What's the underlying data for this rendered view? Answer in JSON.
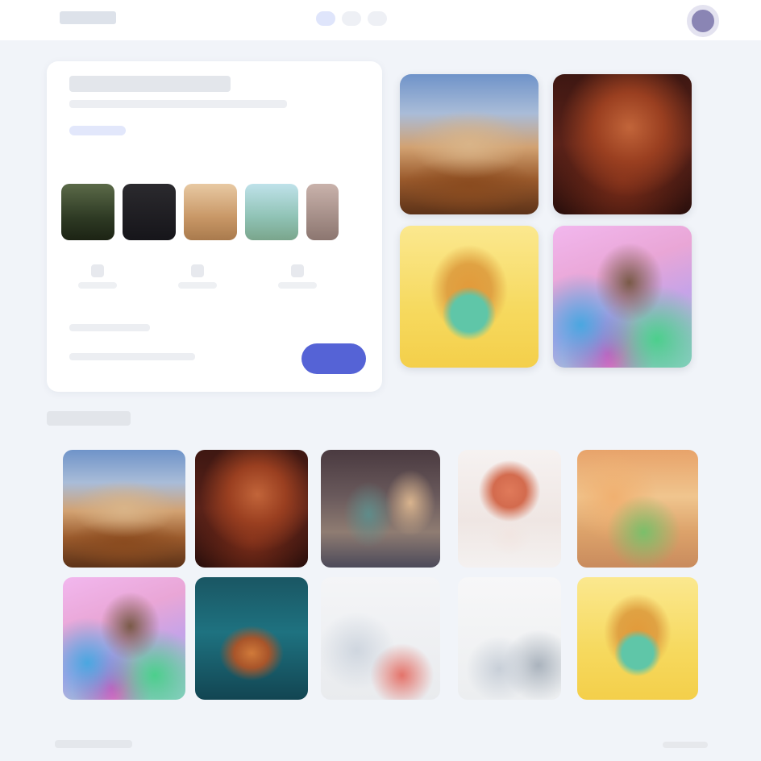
{
  "header": {
    "brand": "",
    "nav": [
      {
        "label": "",
        "active": true
      },
      {
        "label": "",
        "active": false
      },
      {
        "label": "",
        "active": false
      }
    ],
    "avatar_icon": "user-avatar"
  },
  "hero": {
    "title": "",
    "subtitle": "",
    "link": "",
    "style_chips": [
      {
        "icon": "forest-thumb"
      },
      {
        "icon": "dark-thumb"
      },
      {
        "icon": "warm-thumb"
      },
      {
        "icon": "landscape-thumb"
      },
      {
        "icon": "portrait-thumb"
      }
    ],
    "options": [
      {
        "label": ""
      },
      {
        "label": ""
      },
      {
        "label": ""
      }
    ],
    "footer_line_1": "",
    "footer_line_2": "",
    "cta_label": ""
  },
  "featured": [
    {
      "name": "mountain-village-image"
    },
    {
      "name": "lion-portrait-image"
    },
    {
      "name": "toy-figure-image"
    },
    {
      "name": "colorful-collage-image"
    }
  ],
  "gallery": {
    "title": "",
    "items": [
      {
        "name": "mountain-village-image"
      },
      {
        "name": "lion-portrait-image"
      },
      {
        "name": "machine-scene-image"
      },
      {
        "name": "portrait-figure-image"
      },
      {
        "name": "market-scene-image"
      },
      {
        "name": "colorful-collage-image"
      },
      {
        "name": "aquarium-fish-image"
      },
      {
        "name": "sketch-scene-image"
      },
      {
        "name": "draft-scene-image"
      },
      {
        "name": "toy-figure-image"
      }
    ]
  },
  "footer": {
    "text": "",
    "link": ""
  },
  "colors": {
    "background": "#f1f4f9",
    "card": "#ffffff",
    "accent": "#5563d6",
    "nav_active": "#dfe5fb"
  }
}
